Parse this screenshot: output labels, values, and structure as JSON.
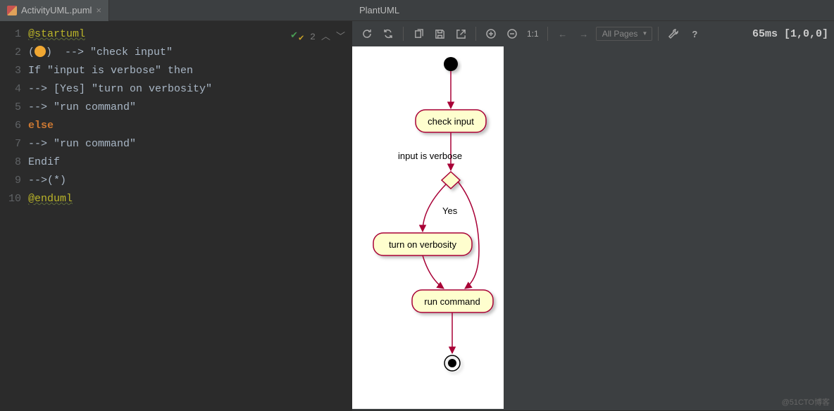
{
  "tab": {
    "filename": "ActivityUML.puml"
  },
  "preview": {
    "title": "PlantUML",
    "pages_label": "All Pages",
    "timing": "65ms [1,0,0]",
    "zoom_label": "1:1"
  },
  "indicators": {
    "warnings": "2"
  },
  "gutter": [
    "1",
    "2",
    "3",
    "4",
    "5",
    "6",
    "7",
    "8",
    "9",
    "10"
  ],
  "code": {
    "l1a": "@startuml",
    "l2a": "(",
    "l2b": ")  --> \"check input\"",
    "l3": "If \"input is verbose\" then",
    "l4": "--> [Yes] \"turn on verbosity\"",
    "l5": "--> \"run command\"",
    "l6": "else",
    "l7": "--> \"run command\"",
    "l8": "Endif",
    "l9": "-->(*)",
    "l10": "@enduml"
  },
  "diagram": {
    "node_check": "check input",
    "cond_label": "input is verbose",
    "branch_yes": "Yes",
    "node_verb": "turn on verbosity",
    "node_run": "run command"
  },
  "watermark": "@51CTO博客"
}
